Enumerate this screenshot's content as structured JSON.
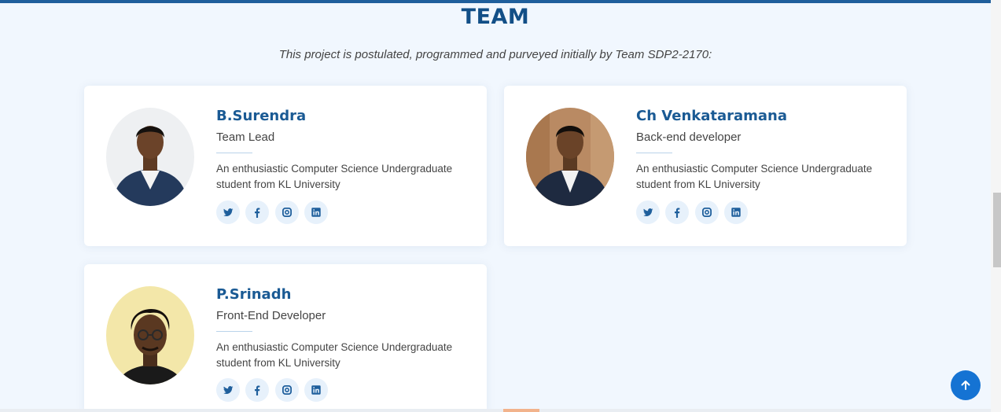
{
  "section": {
    "title": "TEAM",
    "subtitle": "This project is postulated, programmed and purveyed initially by Team SDP2-2170:"
  },
  "members": [
    {
      "name": "B.Surendra",
      "role": "Team Lead",
      "bio": "An enthusiastic Computer Science Undergraduate student from KL University",
      "socials": [
        "twitter-icon",
        "facebook-icon",
        "instagram-icon",
        "linkedin-icon"
      ]
    },
    {
      "name": "Ch Venkataramana",
      "role": "Back-end developer",
      "bio": "An enthusiastic Computer Science Undergraduate student from KL University",
      "socials": [
        "twitter-icon",
        "facebook-icon",
        "instagram-icon",
        "linkedin-icon"
      ]
    },
    {
      "name": "P.Srinadh",
      "role": "Front-End Developer",
      "bio": "An enthusiastic Computer Science Undergraduate student from KL University",
      "socials": [
        "twitter-icon",
        "facebook-icon",
        "instagram-icon",
        "linkedin-icon"
      ]
    }
  ],
  "back_to_top": {
    "icon": "arrow-up-icon"
  },
  "colors": {
    "primary": "#124f87",
    "accent_button": "#1573d3",
    "background": "#f1f7fe",
    "social_bg": "#e7f1fb"
  }
}
